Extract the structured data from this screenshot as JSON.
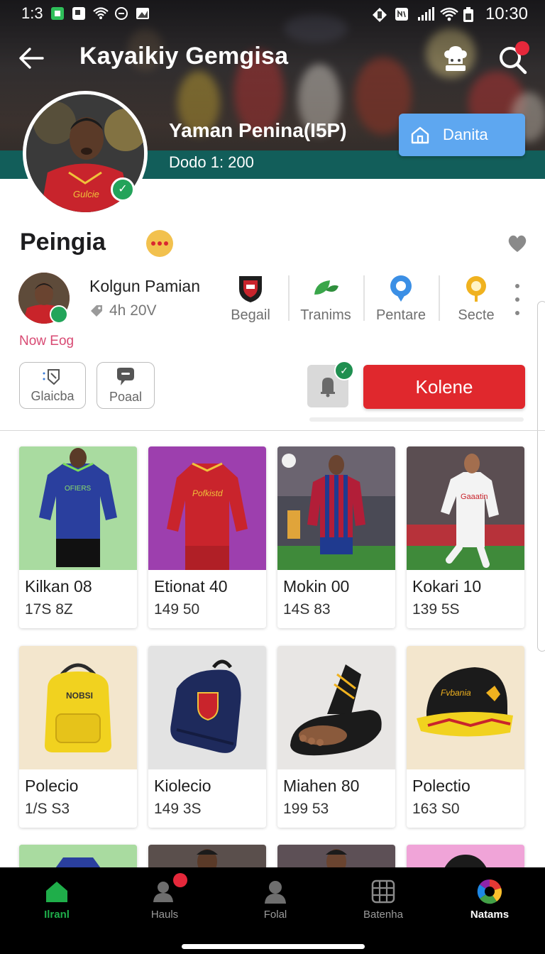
{
  "statusbar": {
    "time_left": "1:3",
    "time": "10:30"
  },
  "header": {
    "title": "Kayaikiy Gemgisa",
    "player_name": "Yaman Penina(I5P)",
    "player_sub": "Dodo 1: 200",
    "action_button": "Danita"
  },
  "profile": {
    "section_title": "Peingia",
    "seller_name": "Kolgun Pamian",
    "seller_meta": "4h 20V",
    "blog_link": "Now Eog"
  },
  "categories": [
    {
      "label": "Begail",
      "icon": "club-crest-icon"
    },
    {
      "label": "Tranims",
      "icon": "leaf-icon"
    },
    {
      "label": "Pentare",
      "icon": "location-pin-icon"
    },
    {
      "label": "Secte",
      "icon": "map-marker-icon"
    }
  ],
  "chips": [
    {
      "label": "Glaicba",
      "icon": "tag-icon"
    },
    {
      "label": "Poaal",
      "icon": "chat-icon"
    }
  ],
  "follow_button": "Kolene",
  "products": [
    {
      "name": "Kilkan 08",
      "price": "17S 8Z"
    },
    {
      "name": "Etionat 40",
      "price": "149 50"
    },
    {
      "name": "Mokin 00",
      "price": "14S 83"
    },
    {
      "name": "Kokari 10",
      "price": "139 5S"
    },
    {
      "name": "Polecio",
      "price": "1/S S3"
    },
    {
      "name": "Kiolecio",
      "price": "149 3S"
    },
    {
      "name": "Miahen 80",
      "price": "199 53"
    },
    {
      "name": "Polectio",
      "price": "163 S0"
    }
  ],
  "bottom_nav": [
    {
      "label": "Ilranl",
      "icon": "home-icon"
    },
    {
      "label": "Hauls",
      "icon": "profile-badge-icon"
    },
    {
      "label": "Folal",
      "icon": "person-icon"
    },
    {
      "label": "Batenha",
      "icon": "grid-icon"
    },
    {
      "label": "Natams",
      "icon": "color-wheel-icon"
    }
  ],
  "colors": {
    "accent_green": "#1fae4a",
    "follow_red": "#e0282d",
    "action_blue": "#5ea7f0",
    "band_teal": "#125e5a"
  }
}
